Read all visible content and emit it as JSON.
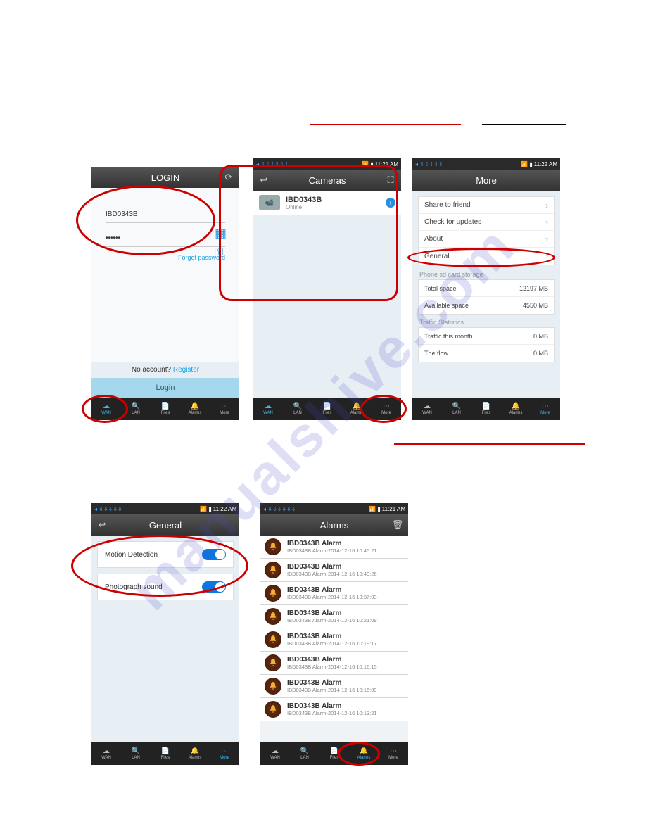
{
  "watermark": "manualshive.com",
  "status_time_a": "11:21 AM",
  "status_time_b": "11:22 AM",
  "login": {
    "title": "LOGIN",
    "id_value": "IBD0343B",
    "password_masked": "••••••",
    "forgot": "Forgot password",
    "no_account": "No account?",
    "register": "Register",
    "login_btn": "Login"
  },
  "cameras": {
    "title": "Cameras",
    "item_name": "IBD0343B",
    "item_status": "Online"
  },
  "more": {
    "title": "More",
    "items": [
      "Share to friend",
      "Check for updates",
      "About",
      "General"
    ],
    "section1_label": "Phone sd card storage",
    "total_label": "Total space",
    "total_value": "12197 MB",
    "avail_label": "Available space",
    "avail_value": "4550 MB",
    "section2_label": "Traffic Statistics",
    "traffic_month_label": "Traffic this month",
    "traffic_month_value": "0 MB",
    "flow_label": "The flow",
    "flow_value": "0 MB"
  },
  "general": {
    "title": "General",
    "motion": "Motion Detection",
    "photo": "Photograph sound"
  },
  "alarms": {
    "title": "Alarms",
    "item_title": "IBD0343B Alarm",
    "items_sub": [
      "IBD0343B Alarm-2014-12-16 10:45:21",
      "IBD0343B Alarm-2014-12-16 10:40:26",
      "IBD0343B Alarm-2014-12-16 10:37:03",
      "IBD0343B Alarm-2014-12-16 10:21:09",
      "IBD0343B Alarm-2014-12-16 10:19:17",
      "IBD0343B Alarm-2014-12-16 10:16:15",
      "IBD0343B Alarm-2014-12-16 10:16:09",
      "IBD0343B Alarm-2014-12-16 10:13:21"
    ]
  },
  "nav": {
    "tabs": [
      "WAN",
      "LAN",
      "Files",
      "Alarms",
      "More"
    ]
  }
}
